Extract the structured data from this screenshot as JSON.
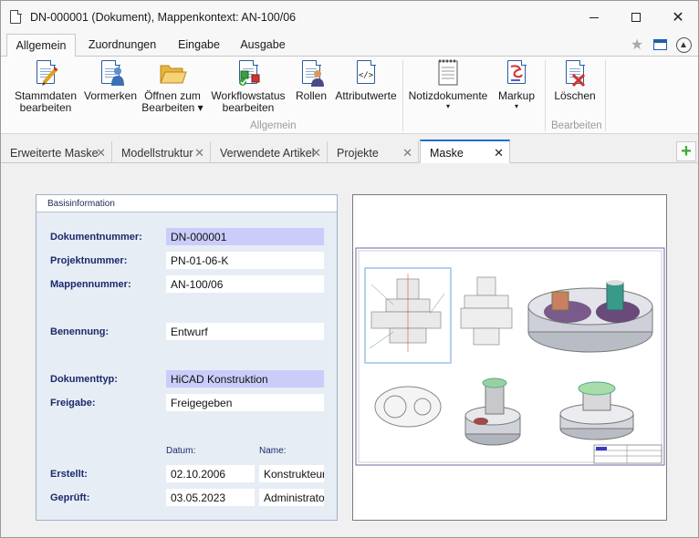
{
  "window": {
    "title": "DN-000001 (Dokument), Mappenkontext: AN-100/06",
    "icons": {
      "document": "document-icon",
      "minimize": "minimize-icon",
      "maximize": "maximize-icon",
      "close": "close-icon"
    },
    "close_glyph": "✕"
  },
  "ribbon_tabs": [
    "Allgemein",
    "Zuordnungen",
    "Eingabe",
    "Ausgabe"
  ],
  "ribbon_tab_active": "Allgemein",
  "ribbon_right_icons": [
    "star-icon",
    "panel-icon",
    "collapse-ribbon-icon"
  ],
  "ribbon_right_glyphs": {
    "star": "★",
    "collapse": "▲"
  },
  "ribbon": {
    "groups": [
      {
        "label": "Allgemein",
        "buttons": [
          {
            "line1": "Stammdaten",
            "line2": "bearbeiten",
            "icon": "edit-document-icon"
          },
          {
            "line1": "Vormerken",
            "line2": "",
            "icon": "reserve-document-icon"
          },
          {
            "line1": "Öffnen zum",
            "line2": "Bearbeiten",
            "icon": "folder-open-icon",
            "dropdown": true
          },
          {
            "line1": "Workflowstatus",
            "line2": "bearbeiten",
            "icon": "workflow-status-icon"
          },
          {
            "line1": "Rollen",
            "line2": "",
            "icon": "roles-icon"
          },
          {
            "line1": "Attributwerte",
            "line2": "",
            "icon": "attribute-values-icon"
          }
        ]
      },
      {
        "label": "",
        "buttons": [
          {
            "line1": "Notizdokumente",
            "line2": "",
            "icon": "note-documents-icon",
            "dropdown": true
          },
          {
            "line1": "Markup",
            "line2": "",
            "icon": "markup-icon",
            "dropdown": true
          }
        ]
      },
      {
        "label": "Bearbeiten",
        "buttons": [
          {
            "line1": "Löschen",
            "line2": "",
            "icon": "delete-document-icon"
          }
        ]
      }
    ],
    "dropdown_glyph": "▾"
  },
  "doc_tabs": [
    {
      "label": "Erweiterte Maske",
      "active": false
    },
    {
      "label": "Modellstruktur",
      "active": false
    },
    {
      "label": "Verwendete Artikel",
      "active": false
    },
    {
      "label": "Projekte",
      "active": false
    },
    {
      "label": "Maske",
      "active": true
    }
  ],
  "tab_close_glyph": "✕",
  "add_tab_glyph": "+",
  "basis": {
    "title": "Basisinformation",
    "fields": [
      {
        "label": "Dokumentnummer:",
        "value": "DN-000001",
        "highlight": true
      },
      {
        "label": "Projektnummer:",
        "value": "PN-01-06-K",
        "highlight": false
      },
      {
        "label": "Mappennummer:",
        "value": "AN-100/06",
        "highlight": false
      },
      {
        "label": "Benennung:",
        "value": "Entwurf",
        "highlight": false
      },
      {
        "label": "Dokumenttyp:",
        "value": "HiCAD Konstruktion",
        "highlight": true
      },
      {
        "label": "Freigabe:",
        "value": "Freigegeben",
        "highlight": false
      }
    ],
    "col_datum": "Datum:",
    "col_name": "Name:",
    "rows": [
      {
        "label": "Erstellt:",
        "datum": "02.10.2006",
        "name": "Konstrukteur"
      },
      {
        "label": "Geprüft:",
        "datum": "03.05.2023",
        "name": "Administrator"
      }
    ]
  },
  "preview": {
    "icon": "drawing-preview-image"
  },
  "colors": {
    "accent": "#1e6fd0",
    "label": "#1b2a6b",
    "highlight": "#ccccfa",
    "groupbox": "#e7edf5"
  }
}
